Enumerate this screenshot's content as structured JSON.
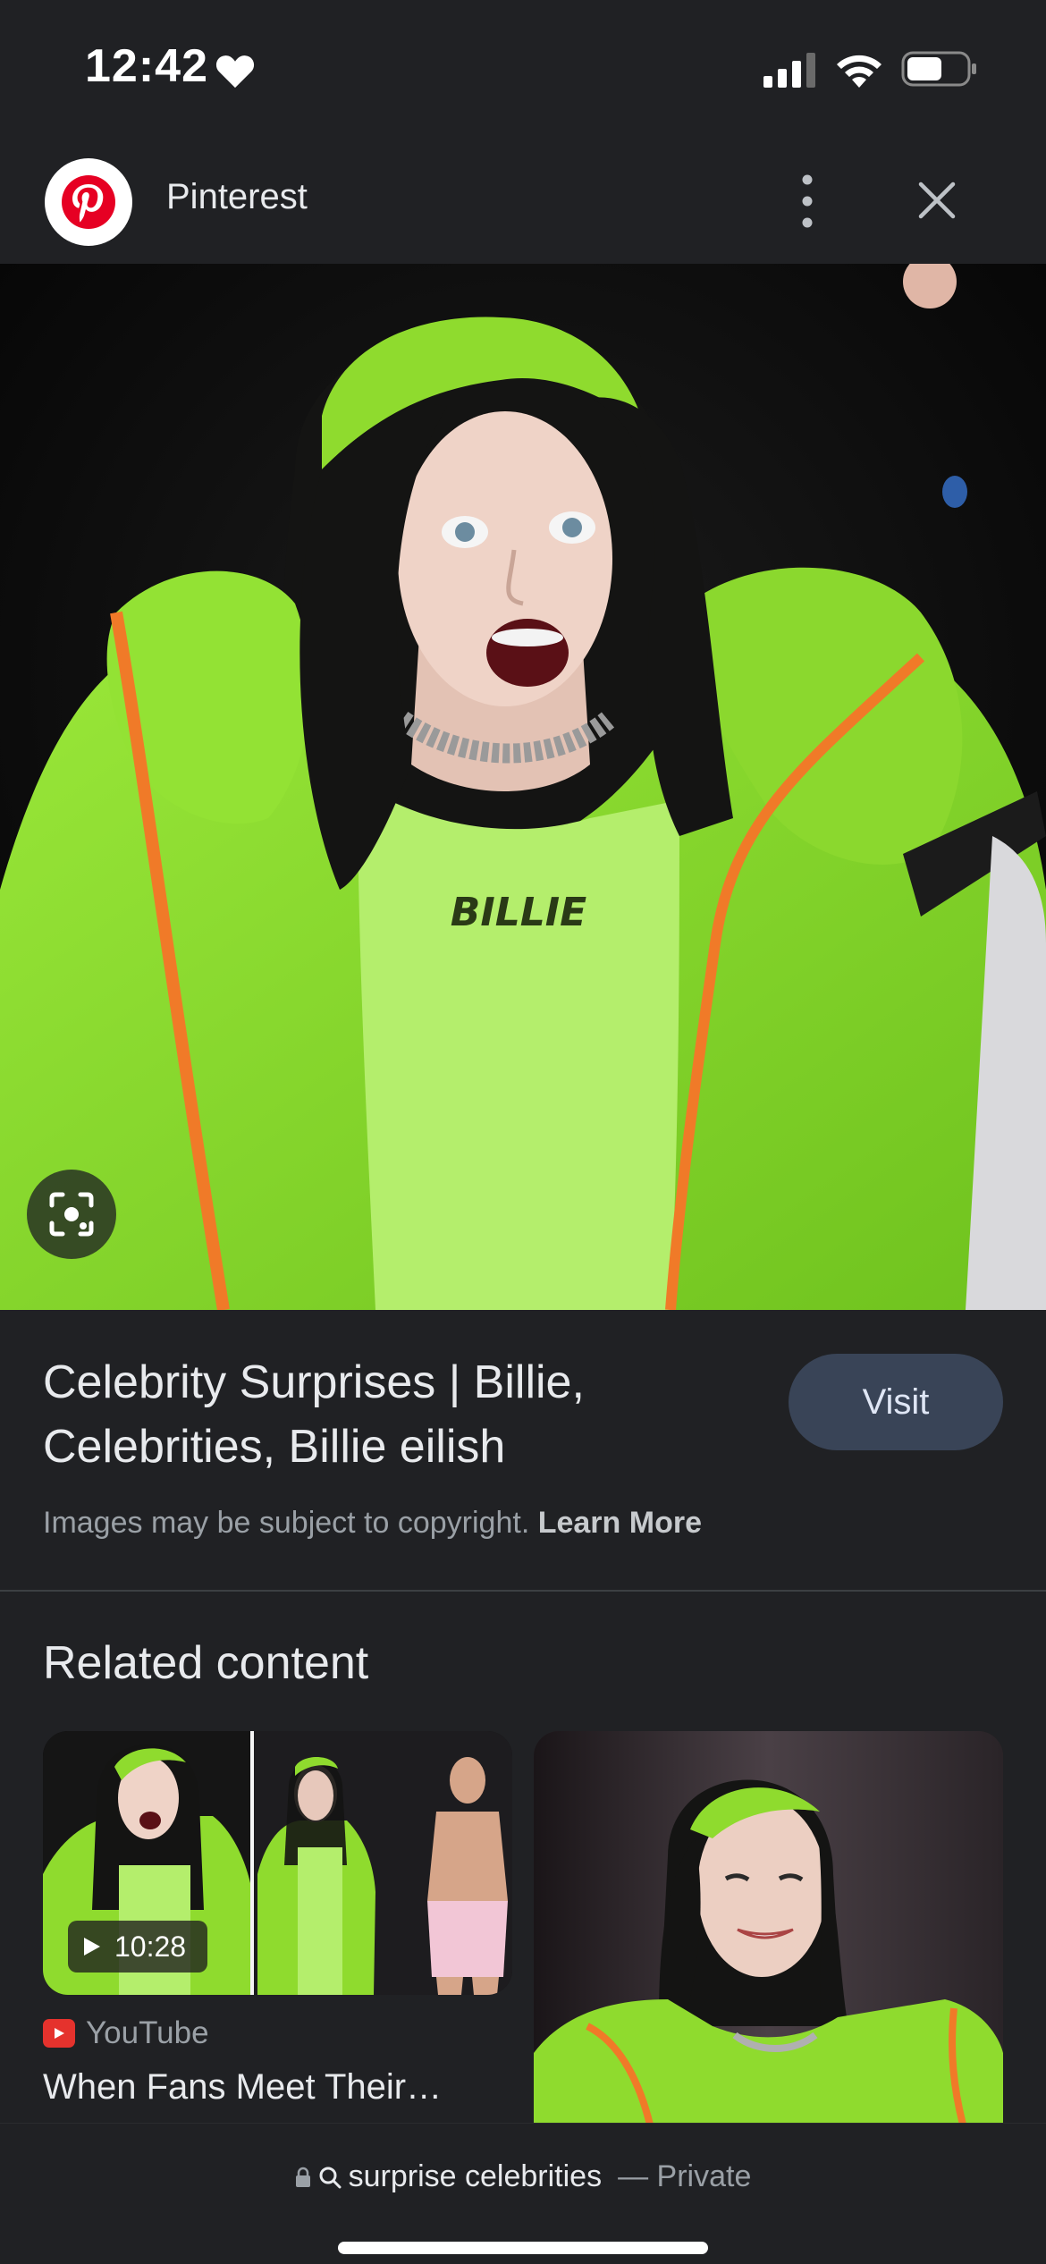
{
  "status_bar": {
    "time": "12:42"
  },
  "source": {
    "name": "Pinterest"
  },
  "result": {
    "title": "Celebrity Surprises | Billie, Celebrities, Billie eilish",
    "visit_label": "Visit",
    "copyright_text": "Images may be subject to copyright.",
    "learn_more": "Learn More"
  },
  "hero": {
    "shirt_text": "BILLIE"
  },
  "related": {
    "heading": "Related content",
    "items": [
      {
        "duration": "10:28",
        "source": "YouTube",
        "title": "When Fans Meet Their…"
      },
      {
        "title": ""
      }
    ]
  },
  "address_bar": {
    "query": "surprise celebrities",
    "mode": "— Private"
  },
  "colors": {
    "background": "#202124",
    "visit_button": "#394457",
    "jacket_green": "#8fdb2e",
    "youtube_red": "#e5322d",
    "pinterest_red": "#e60023"
  },
  "icons": [
    "heart-icon",
    "signal-icon",
    "wifi-icon",
    "battery-icon",
    "pinterest-logo-icon",
    "more-vert-icon",
    "close-icon",
    "lens-icon",
    "play-icon",
    "youtube-logo-icon",
    "lock-icon",
    "search-icon"
  ]
}
